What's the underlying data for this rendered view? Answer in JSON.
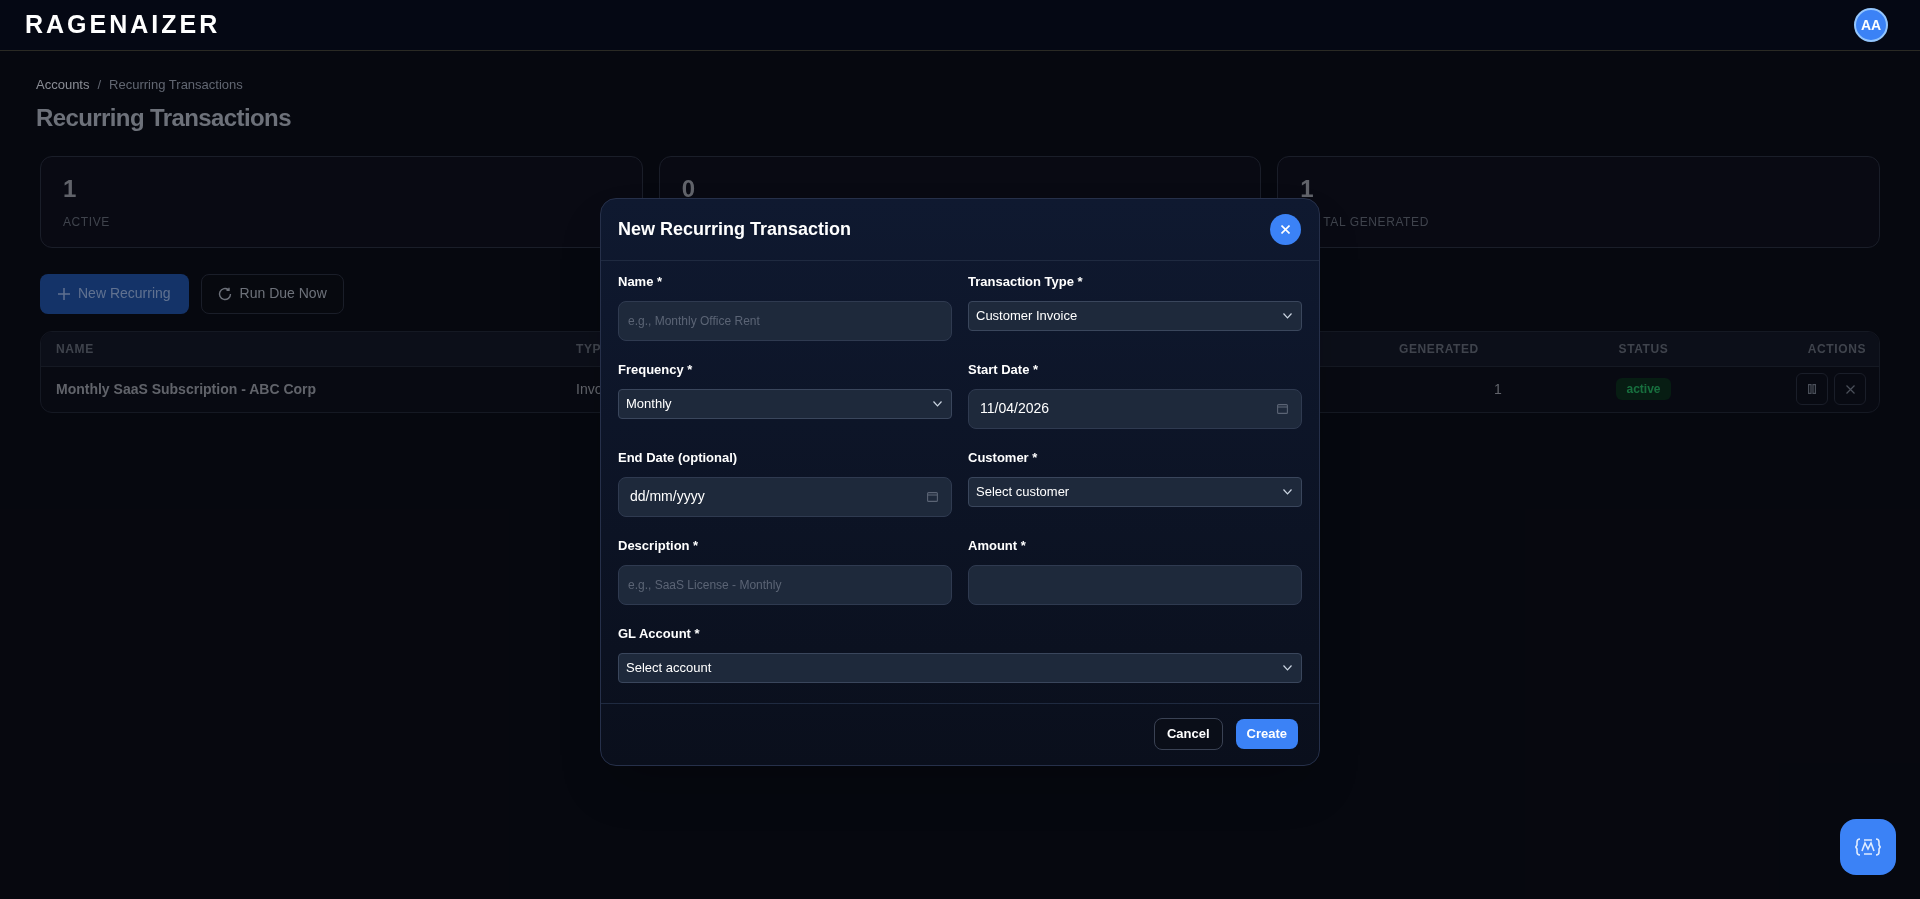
{
  "header": {
    "logo": "RAGENAIZER",
    "avatar": "AA"
  },
  "breadcrumb": [
    {
      "label": "Accounts"
    },
    {
      "label": "Recurring Transactions"
    }
  ],
  "breadcrumb_separator": "/",
  "page_title": "Recurring Transactions",
  "stats": [
    {
      "value": "1",
      "label": "ACTIVE"
    },
    {
      "value": "0"
    },
    {
      "value": "1",
      "label": "TAL GENERATED"
    }
  ],
  "actions": [
    {
      "kind": "primary",
      "label": "New Recurring"
    },
    {
      "kind": "secondary",
      "label": "Run Due Now"
    }
  ],
  "table": {
    "columns": [
      "NAME",
      "TYP",
      "GENERATED",
      "STATUS",
      "ACTIONS"
    ],
    "rows": [
      {
        "name": "Monthly SaaS Subscription - ABC Corp",
        "type": "Invo",
        "generated": "1",
        "status": "active"
      }
    ]
  },
  "modal": {
    "title": "New Recurring Transaction",
    "fields": [
      {
        "kind": "text",
        "label": "Name *",
        "placeholder": "e.g., Monthly Office Rent"
      },
      {
        "kind": "select",
        "label": "Transaction Type *",
        "value": "Customer Invoice"
      },
      {
        "kind": "select",
        "label": "Frequency *",
        "value": "Monthly"
      },
      {
        "kind": "date",
        "label": "Start Date *",
        "value": "11/04/2026"
      },
      {
        "kind": "date",
        "label": "End Date (optional)",
        "value": "dd/mm/yyyy"
      },
      {
        "kind": "select",
        "label": "Customer *",
        "value": "Select customer"
      },
      {
        "kind": "text",
        "label": "Description *",
        "placeholder": "e.g., SaaS License - Monthly"
      },
      {
        "kind": "text",
        "label": "Amount *"
      },
      {
        "kind": "select",
        "label": "GL Account *",
        "value": "Select account",
        "wide": true
      }
    ],
    "buttons": [
      {
        "kind": "secondary",
        "label": "Cancel"
      },
      {
        "kind": "primary",
        "label": "Create"
      }
    ]
  }
}
